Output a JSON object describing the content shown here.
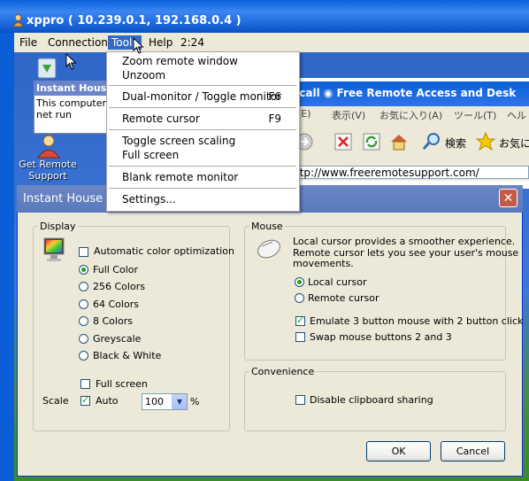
{
  "window": {
    "title": "xppro ( 10.239.0.1, 192.168.0.4 )"
  },
  "menubar": {
    "items": [
      {
        "label": "File"
      },
      {
        "label": "Connection"
      },
      {
        "label": "Tools"
      },
      {
        "label": "Help"
      },
      {
        "label": "2:24"
      }
    ]
  },
  "tools_menu": {
    "items": [
      {
        "label": "Zoom remote window",
        "shortcut": ""
      },
      {
        "label": "Unzoom",
        "shortcut": ""
      },
      {
        "label": "Dual-monitor / Toggle monitor",
        "shortcut": "F6"
      },
      {
        "label": "Remote cursor",
        "shortcut": "F9"
      },
      {
        "label": "Toggle screen scaling",
        "shortcut": ""
      },
      {
        "label": "Full screen",
        "shortcut": ""
      },
      {
        "label": "Blank remote monitor",
        "shortcut": ""
      },
      {
        "label": "Settings...",
        "shortcut": ""
      }
    ]
  },
  "desktop": {
    "icon_label_1": "Get Remote",
    "icon_label_2": "Support",
    "popup_title": "Instant House",
    "popup_line1": "This computer is",
    "popup_line2": "net run"
  },
  "browser": {
    "title": "secall ◉ Free Remote Access and Desk",
    "menu": [
      "(E)",
      "表示(V)",
      "お気に入り(A)",
      "ツール(T)",
      "ヘル"
    ],
    "search_label": "検索",
    "favorites_label": "お気に",
    "address": "ttp://www.freeremotesupport.com/"
  },
  "dialog": {
    "title": "Instant House",
    "display": {
      "label": "Display",
      "auto_color": "Automatic color optimization",
      "options": [
        "Full Color",
        "256 Colors",
        "64 Colors",
        "8 Colors",
        "Greyscale",
        "Black & White"
      ],
      "selected": "Full Color",
      "fullscreen": "Full screen",
      "scale_label": "Scale",
      "auto_label": "Auto",
      "scale_value": "100",
      "percent": "%"
    },
    "mouse": {
      "label": "Mouse",
      "description": [
        "Local cursor provides a smoother experience.",
        "Remote cursor lets you see your user's mouse",
        "movements."
      ],
      "local": "Local cursor",
      "remote": "Remote cursor",
      "emulate": "Emulate 3 button mouse with 2 button click",
      "swap": "Swap mouse buttons 2 and 3"
    },
    "convenience": {
      "label": "Convenience",
      "clipboard": "Disable clipboard sharing"
    },
    "ok": "OK",
    "cancel": "Cancel"
  },
  "colors": {
    "title_blue": "#0a5fd8",
    "dialog_bg": "#ece9d8",
    "menu_highlight": "#316ac5"
  }
}
